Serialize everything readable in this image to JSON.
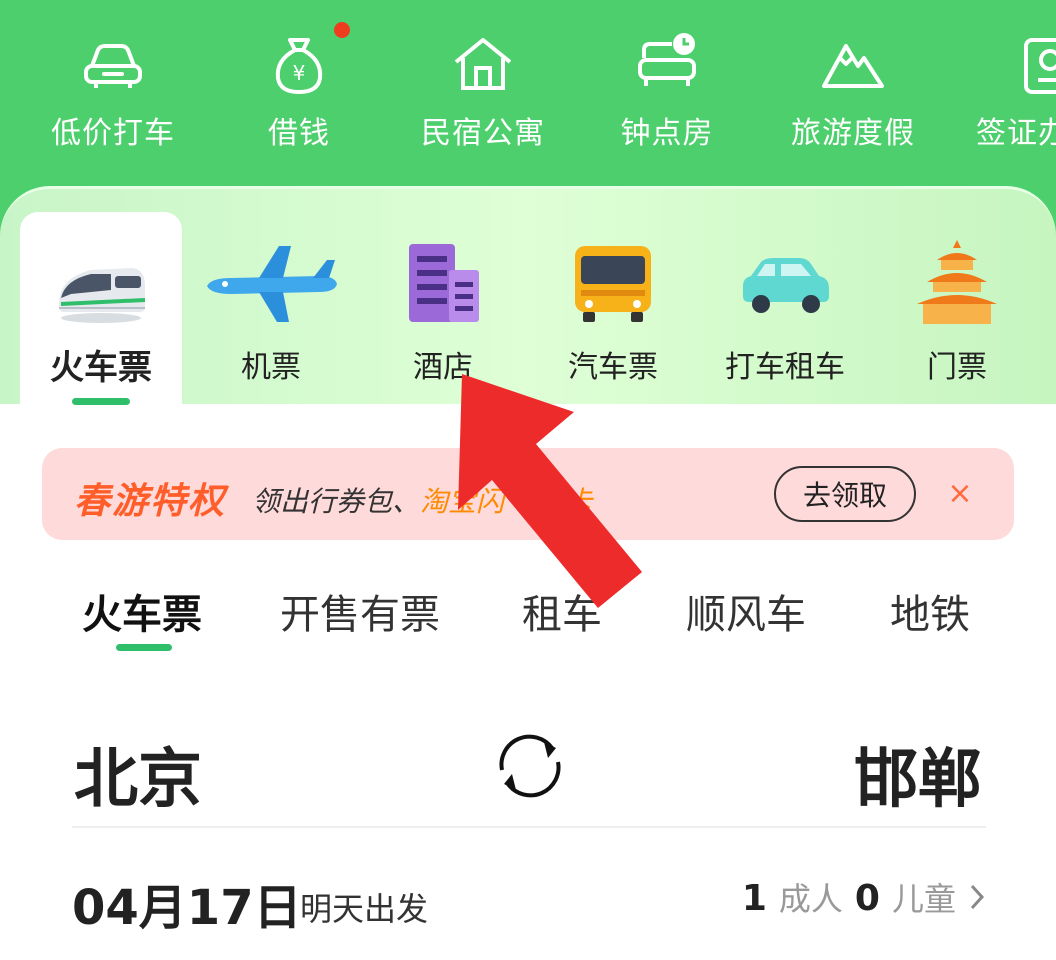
{
  "top_services": [
    {
      "label": "低价打车",
      "icon": "car-icon"
    },
    {
      "label": "借钱",
      "icon": "money-bag-icon",
      "badge_dot": true
    },
    {
      "label": "民宿公寓",
      "icon": "house-icon"
    },
    {
      "label": "钟点房",
      "icon": "bed-clock-icon"
    },
    {
      "label": "旅游度假",
      "icon": "mountain-icon"
    },
    {
      "label": "签证办",
      "icon": "passport-icon"
    }
  ],
  "categories": [
    {
      "label": "火车票",
      "icon": "train-icon",
      "active": true
    },
    {
      "label": "机票",
      "icon": "airplane-icon"
    },
    {
      "label": "酒店",
      "icon": "hotel-icon"
    },
    {
      "label": "汽车票",
      "icon": "bus-icon"
    },
    {
      "label": "打车租车",
      "icon": "taxi-icon"
    },
    {
      "label": "门票",
      "icon": "temple-icon"
    }
  ],
  "promo": {
    "title": "春游特权",
    "desc_plain": "领出行券包、",
    "desc_highlight": "淘宝闪",
    "desc_tail": "卡",
    "button": "去领取",
    "close": "×"
  },
  "subtabs": [
    {
      "label": "火车票",
      "active": true
    },
    {
      "label": "开售有票"
    },
    {
      "label": "租车"
    },
    {
      "label": "顺风车"
    },
    {
      "label": "地铁"
    }
  ],
  "route": {
    "from": "北京",
    "to": "邯郸"
  },
  "trip": {
    "date": "04月17日",
    "date_note": "明天出发",
    "adults_count": "1",
    "adults_label": "成人",
    "children_count": "0",
    "children_label": "儿童"
  },
  "colors": {
    "brand_green": "#4ecf6d",
    "accent_green": "#2fbf6b",
    "promo_orange": "#ff5d2a",
    "arrow_red": "#ee2b2b"
  }
}
